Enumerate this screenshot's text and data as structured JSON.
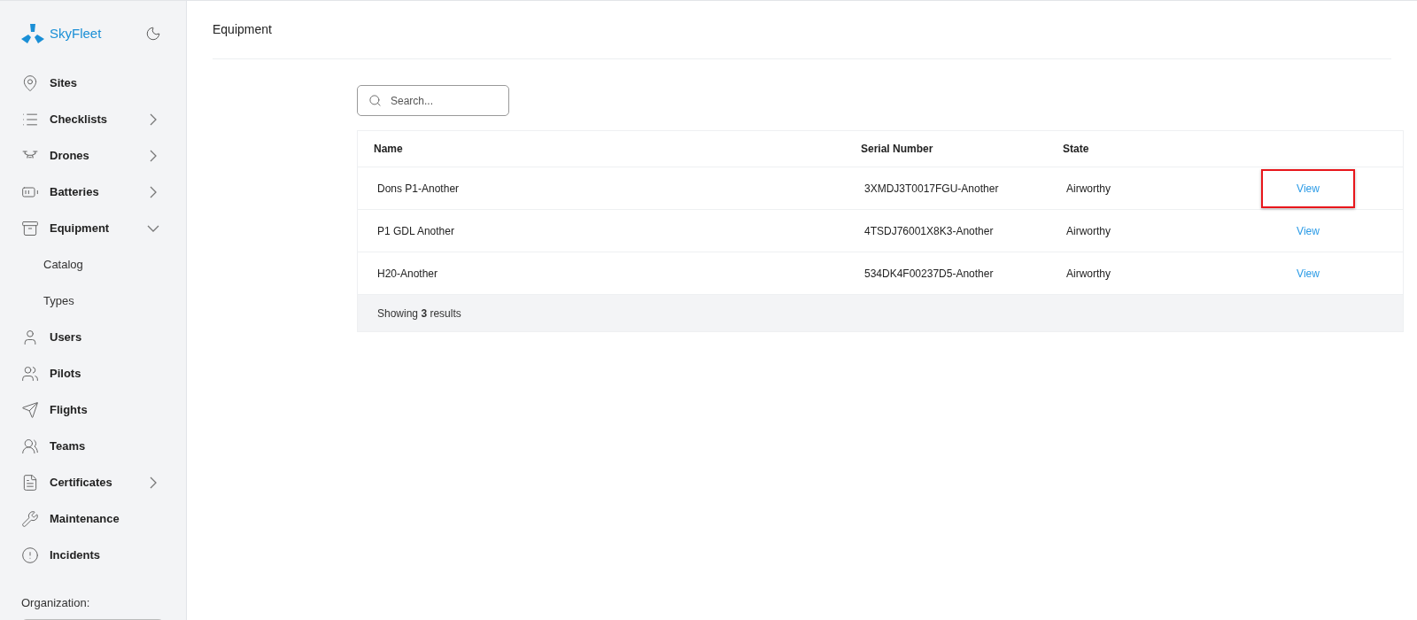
{
  "sidebar": {
    "brand": "SkyFleet",
    "items": [
      {
        "kind": "item",
        "label": "Sites"
      },
      {
        "kind": "group",
        "label": "Checklists",
        "expanded": false
      },
      {
        "kind": "group",
        "label": "Drones",
        "expanded": false
      },
      {
        "kind": "group",
        "label": "Batteries",
        "expanded": false
      },
      {
        "kind": "group",
        "label": "Equipment",
        "expanded": true,
        "children": [
          {
            "label": "Catalog"
          },
          {
            "label": "Types"
          }
        ]
      },
      {
        "kind": "item",
        "label": "Users"
      },
      {
        "kind": "item",
        "label": "Pilots"
      },
      {
        "kind": "item",
        "label": "Flights"
      },
      {
        "kind": "item",
        "label": "Teams"
      },
      {
        "kind": "group",
        "label": "Certificates",
        "expanded": false
      },
      {
        "kind": "item",
        "label": "Maintenance"
      },
      {
        "kind": "item",
        "label": "Incidents"
      }
    ],
    "organization_label": "Organization:"
  },
  "page": {
    "title": "Equipment"
  },
  "search": {
    "placeholder": "Search..."
  },
  "table": {
    "columns": [
      "Name",
      "Serial Number",
      "State"
    ],
    "rows": [
      {
        "name": "Dons P1-Another",
        "serial": "3XMDJ3T0017FGU-Another",
        "state": "Airworthy",
        "action": "View",
        "highlighted": true
      },
      {
        "name": "P1 GDL Another",
        "serial": "4TSDJ76001X8K3-Another",
        "state": "Airworthy",
        "action": "View",
        "highlighted": false
      },
      {
        "name": "H20-Another",
        "serial": "534DK4F00237D5-Another",
        "state": "Airworthy",
        "action": "View",
        "highlighted": false
      }
    ],
    "footer": "Showing **3** results"
  }
}
